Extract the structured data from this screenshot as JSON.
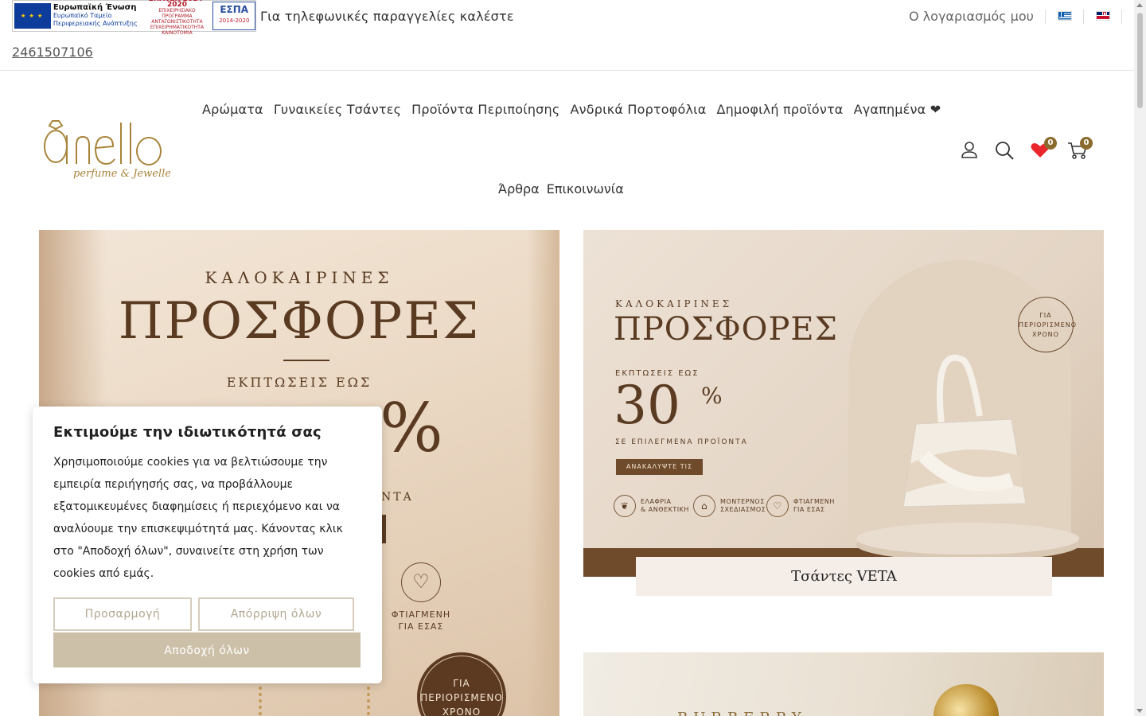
{
  "topbar": {
    "funding_banner": {
      "eu_title": "Ευρωπαϊκή Ένωση",
      "eu_fund_line1": "Ευρωπαϊκό Ταμείο",
      "eu_fund_line2": "Περιφερειακής Ανάπτυξης",
      "epanek_title": "ΕΠΑνΕΚ 2014-2020",
      "epanek_sub": "ΕΠΙΧΕΙΡΗΣΙΑΚΟ ΠΡΟΓΡΑΜΜΑ ΑΝΤΑΓΩΝΙΣΤΙΚΟΤΗΤΑ ΕΠΙΧΕΙΡΗΜΑΤΙΚΟΤΗΤΑ ΚΑΙΝΟΤΟΜΙΑ",
      "espa_title": "ΕΣΠΑ",
      "espa_years": "2014-2020"
    },
    "phone_label": "Για τηλεφωνικές παραγγελίες καλέστε",
    "phone_number": "2461507106",
    "account_link": "Ο λογαριασμός μου",
    "languages": [
      "gr-flag-icon",
      "en-flag-icon"
    ]
  },
  "header": {
    "logo_alt": "Anello perfume & Jewellery",
    "nav_items": [
      "Αρώματα",
      "Γυναικείες Τσάντες",
      "Προϊόντα Περιποίησης",
      "Ανδρικά Πορτοφόλια",
      "Δημοφιλή προϊόντα",
      "Αγαπημένα ❤"
    ],
    "nav_items_row2": [
      "Άρθρα",
      "Επικοινωνία"
    ],
    "icons": [
      "user-icon",
      "search-icon",
      "heart-icon",
      "cart-icon"
    ],
    "wishlist_count": "0",
    "cart_count": "0"
  },
  "banners": {
    "left": {
      "subtitle": "ΚΑΛΟΚΑΙΡΙΝΕΣ",
      "title": "ΠΡΟΣΦΟΡΕΣ",
      "discount_label": "ΕΚΠΤΩΣΕΙΣ ΕΩΣ",
      "big_partial": "%",
      "products_partial": "ΝΤΑ",
      "made_label_line1": "ΦΤΙΑΓΜΕΝΗ",
      "made_label_line2": "ΓΙΑ ΕΣΑΣ",
      "stamp_line1": "ΓΙΑ",
      "stamp_line2": "ΠΕΡΙΟΡΙΣΜΕΝΟ",
      "stamp_line3": "ΧΡΟΝΟ"
    },
    "right": {
      "subtitle": "ΚΑΛΟΚΑΙΡΙΝΕΣ",
      "title": "ΠΡΟΣΦΟΡΕΣ",
      "discount_label": "ΕΚΠΤΩΣΕΙΣ ΕΩΣ",
      "discount_value": "30",
      "percent": "%",
      "selected_label": "ΣΕ ΕΠΙΛΕΓΜΕΝΑ ΠΡΟΪΟΝΤΑ",
      "cta": "ΑΝΑΚΑΛΥΨΤΕ ΤΙΣ",
      "features": [
        {
          "line1": "ΕΛΑΦΡΙΑ",
          "line2": "& ΑΝΘΕΚΤΙΚΗ"
        },
        {
          "line1": "ΜΟΝΤΕΡΝΟΣ",
          "line2": "ΣΧΕΔΙΑΣΜΟΣ"
        },
        {
          "line1": "ΦΤΙΑΓΜΕΝΗ",
          "line2": "ΓΙΑ ΕΣΑΣ"
        }
      ],
      "stamp_line1": "ΓΙΑ",
      "stamp_line2": "ΠΕΡΙΟΡΙΣΜΕΝΟ",
      "stamp_line3": "ΧΡΟΝΟ",
      "caption": "Τσάντες VETA"
    },
    "right2": {
      "brand_partial": "BURBERRY"
    }
  },
  "cookie_banner": {
    "title": "Εκτιμούμε την ιδιωτικότητά σας",
    "text": "Χρησιμοποιούμε cookies για να βελτιώσουμε την εμπειρία περιήγησής σας, να προβάλλουμε εξατομικευμένες διαφημίσεις ή περιεχόμενο και να αναλύουμε την επισκεψιμότητά μας. Κάνοντας κλικ στο \"Αποδοχή όλων\", συναινείτε στη χρήση των cookies από εμάς.",
    "customize_label": "Προσαρμογή",
    "reject_label": "Απόρριψη όλων",
    "accept_label": "Αποδοχή όλων"
  },
  "colors": {
    "accent_gold": "#8b6a2e",
    "banner_brown": "#5a3b22",
    "accept_button": "#ccc0a8",
    "wishlist_heart": "#e8262b"
  }
}
